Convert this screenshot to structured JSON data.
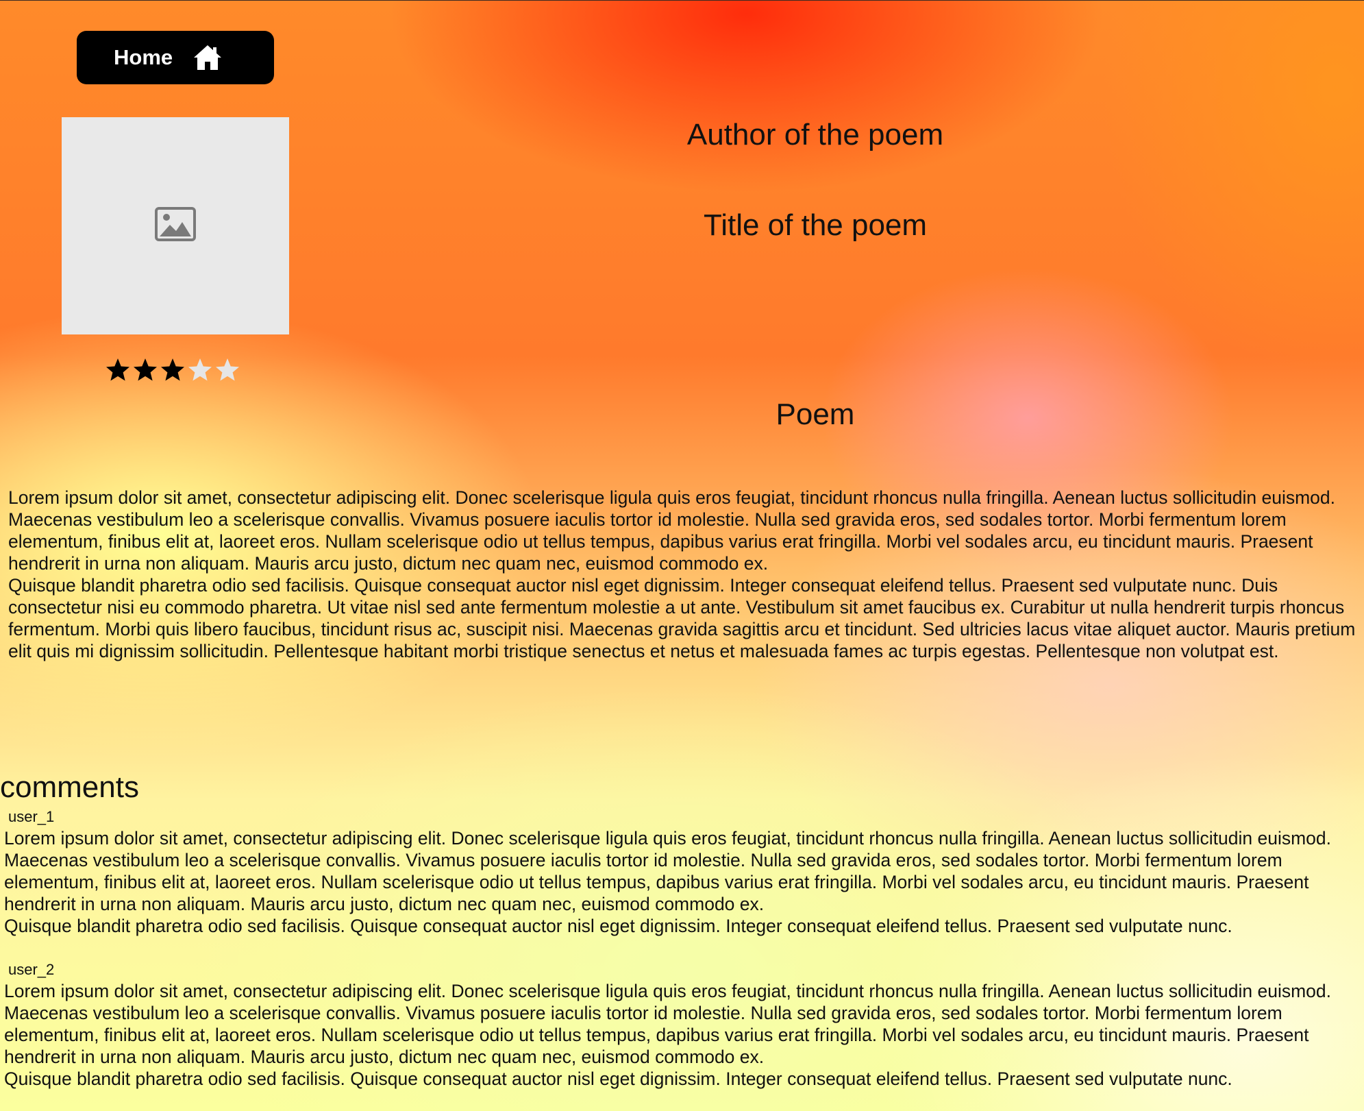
{
  "nav": {
    "home_label": "Home",
    "home_icon": "home-icon"
  },
  "poem": {
    "image_icon": "image-placeholder-icon",
    "rating": 3,
    "rating_max": 5,
    "author": "Author of the poem",
    "title": "Title of the poem",
    "heading": "Poem",
    "paragraphs": [
      "Lorem ipsum dolor sit amet, consectetur adipiscing elit. Donec scelerisque ligula quis eros feugiat, tincidunt rhoncus nulla fringilla. Aenean luctus sollicitudin euismod. Maecenas vestibulum leo a scelerisque convallis. Vivamus posuere iaculis tortor id molestie. Nulla sed gravida eros, sed sodales tortor. Morbi fermentum lorem elementum, finibus elit at, laoreet eros. Nullam scelerisque odio ut tellus tempus, dapibus varius erat fringilla. Morbi vel sodales arcu, eu tincidunt mauris. Praesent hendrerit in urna non aliquam. Mauris arcu justo, dictum nec quam nec, euismod commodo ex.",
      "Quisque blandit pharetra odio sed facilisis. Quisque consequat auctor nisl eget dignissim. Integer consequat eleifend tellus. Praesent sed vulputate nunc. Duis consectetur nisi eu commodo pharetra. Ut vitae nisl sed ante fermentum molestie a ut ante. Vestibulum sit amet faucibus ex. Curabitur ut nulla hendrerit turpis rhoncus fermentum. Morbi quis libero faucibus, tincidunt risus ac, suscipit nisi. Maecenas gravida sagittis arcu et tincidunt. Sed ultricies lacus vitae aliquet auctor. Mauris pretium elit quis mi dignissim sollicitudin. Pellentesque habitant morbi tristique senectus et netus et malesuada fames ac turpis egestas. Pellentesque non volutpat est."
    ]
  },
  "comments": {
    "heading": "comments",
    "items": [
      {
        "user": "user_1",
        "paragraphs": [
          "Lorem ipsum dolor sit amet, consectetur adipiscing elit. Donec scelerisque ligula quis eros feugiat, tincidunt rhoncus nulla fringilla. Aenean luctus sollicitudin euismod. Maecenas vestibulum leo a scelerisque convallis. Vivamus posuere iaculis tortor id molestie. Nulla sed gravida eros, sed sodales tortor. Morbi fermentum lorem elementum, finibus elit at, laoreet eros. Nullam scelerisque odio ut tellus tempus, dapibus varius erat fringilla. Morbi vel sodales arcu, eu tincidunt mauris. Praesent hendrerit in urna non aliquam. Mauris arcu justo, dictum nec quam nec, euismod commodo ex.",
          "Quisque blandit pharetra odio sed facilisis. Quisque consequat auctor nisl eget dignissim. Integer consequat eleifend tellus. Praesent sed vulputate nunc."
        ]
      },
      {
        "user": "user_2",
        "paragraphs": [
          "Lorem ipsum dolor sit amet, consectetur adipiscing elit. Donec scelerisque ligula quis eros feugiat, tincidunt rhoncus nulla fringilla. Aenean luctus sollicitudin euismod. Maecenas vestibulum leo a scelerisque convallis. Vivamus posuere iaculis tortor id molestie. Nulla sed gravida eros, sed sodales tortor. Morbi fermentum lorem elementum, finibus elit at, laoreet eros. Nullam scelerisque odio ut tellus tempus, dapibus varius erat fringilla. Morbi vel sodales arcu, eu tincidunt mauris. Praesent hendrerit in urna non aliquam. Mauris arcu justo, dictum nec quam nec, euismod commodo ex.",
          "Quisque blandit pharetra odio sed facilisis. Quisque consequat auctor nisl eget dignissim. Integer consequat eleifend tellus. Praesent sed vulputate nunc."
        ]
      }
    ]
  },
  "colors": {
    "star_filled": "#000000",
    "star_empty": "#e6e6e6",
    "image_placeholder_bg": "#e9e9e9",
    "image_icon": "#7a7a7a",
    "home_button_bg": "#000000"
  }
}
